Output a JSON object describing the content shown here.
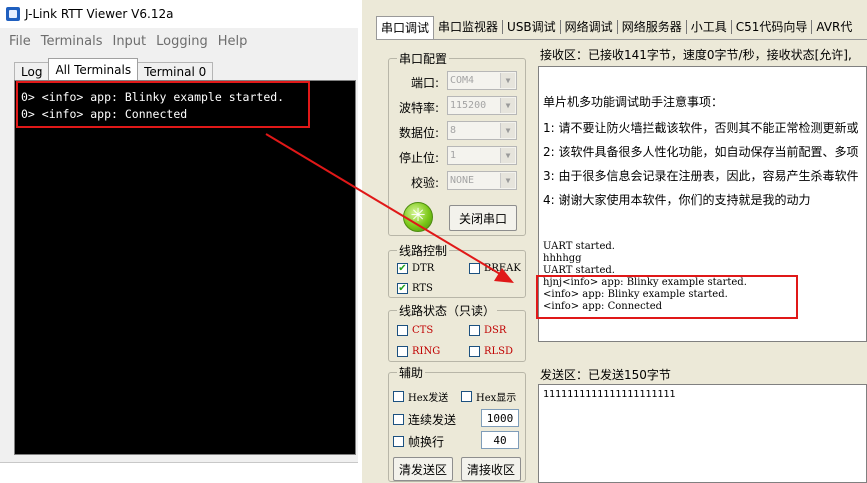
{
  "rtt_viewer": {
    "title": "J-Link RTT Viewer V6.12a",
    "menu": [
      "File",
      "Terminals",
      "Input",
      "Logging",
      "Help"
    ],
    "tabs": [
      "Log",
      "All Terminals",
      "Terminal 0"
    ],
    "active_tab": "All Terminals",
    "terminal_lines": [
      "0> <info> app: Blinky example started.",
      "0> <info> app: Connected"
    ]
  },
  "serial_assistant": {
    "tabs": [
      "串口调试",
      "串口监视器",
      "USB调试",
      "网络调试",
      "网络服务器",
      "小工具",
      "C51代码向导",
      "AVR代"
    ],
    "active_tab": "串口调试",
    "port_config": {
      "title": "串口配置",
      "port_label": "端口:",
      "port_value": "COM4",
      "baud_label": "波特率:",
      "baud_value": "115200",
      "data_bits_label": "数据位:",
      "data_bits_value": "8",
      "stop_bits_label": "停止位:",
      "stop_bits_value": "1",
      "parity_label": "校验:",
      "parity_value": "NONE",
      "close_port_button": "关闭串口"
    },
    "line_control": {
      "title": "线路控制",
      "dtr": "DTR",
      "break": "BREAK",
      "rts": "RTS"
    },
    "line_status": {
      "title": "线路状态（只读）",
      "cts": "CTS",
      "dsr": "DSR",
      "ring": "RING",
      "rlsd": "RLSD"
    },
    "aux": {
      "title": "辅助",
      "hex_send": "Hex发送",
      "hex_display": "Hex显示",
      "continuous_send": "连续发送",
      "continuous_value": "1000",
      "frame_newline": "帧换行",
      "frame_value": "40",
      "clear_send_button": "清发送区",
      "clear_recv_button": "清接收区"
    },
    "receive": {
      "header": "接收区：已接收141字节，速度0字节/秒，接收状态[允许],",
      "notice_title": "单片机多功能调试助手注意事项：",
      "notices": [
        "1: 请不要让防火墙拦截该软件，否则其不能正常检测更新或",
        "2: 该软件具备很多人性化功能，如自动保存当前配置、多项",
        "3: 由于很多信息会记录在注册表，因此，容易产生杀毒软件",
        "4: 谢谢大家使用本软件，你们的支持就是我的动力"
      ],
      "log_lines": [
        "UART started.",
        "hhhhgg",
        "UART started.",
        "hjnj<info> app: Blinky example started.",
        "<info> app: Blinky example started.",
        "<info> app: Connected"
      ]
    },
    "send": {
      "header": "发送区：已发送150字节",
      "content": "1111111111111111111111"
    }
  },
  "colors": {
    "annotation": "#e01818",
    "terminal_bg": "#000000",
    "status_red": "#c00000"
  }
}
